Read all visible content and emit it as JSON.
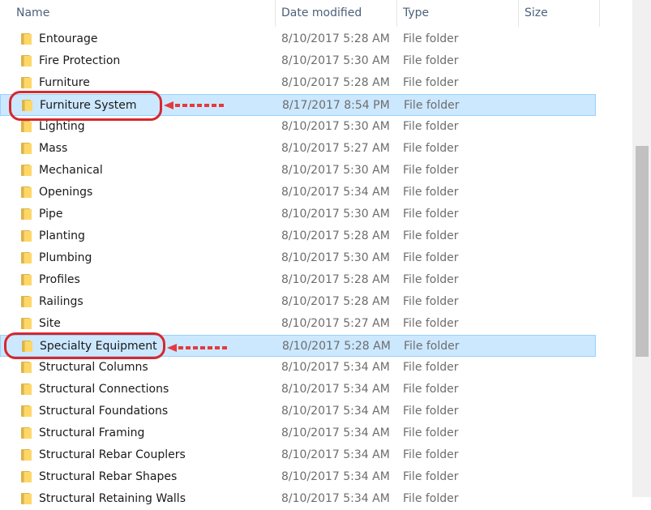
{
  "columns": {
    "name": "Name",
    "date_modified": "Date modified",
    "type": "Type",
    "size": "Size"
  },
  "sort_indicator": "^",
  "rows": [
    {
      "name": "Entourage",
      "date": "8/10/2017 5:28 AM",
      "type": "File folder",
      "selected": false
    },
    {
      "name": "Fire Protection",
      "date": "8/10/2017 5:30 AM",
      "type": "File folder",
      "selected": false
    },
    {
      "name": "Furniture",
      "date": "8/10/2017 5:28 AM",
      "type": "File folder",
      "selected": false
    },
    {
      "name": "Furniture System",
      "date": "8/17/2017 8:54 PM",
      "type": "File folder",
      "selected": true
    },
    {
      "name": "Lighting",
      "date": "8/10/2017 5:30 AM",
      "type": "File folder",
      "selected": false
    },
    {
      "name": "Mass",
      "date": "8/10/2017 5:27 AM",
      "type": "File folder",
      "selected": false
    },
    {
      "name": "Mechanical",
      "date": "8/10/2017 5:30 AM",
      "type": "File folder",
      "selected": false
    },
    {
      "name": "Openings",
      "date": "8/10/2017 5:34 AM",
      "type": "File folder",
      "selected": false
    },
    {
      "name": "Pipe",
      "date": "8/10/2017 5:30 AM",
      "type": "File folder",
      "selected": false
    },
    {
      "name": "Planting",
      "date": "8/10/2017 5:28 AM",
      "type": "File folder",
      "selected": false
    },
    {
      "name": "Plumbing",
      "date": "8/10/2017 5:30 AM",
      "type": "File folder",
      "selected": false
    },
    {
      "name": "Profiles",
      "date": "8/10/2017 5:28 AM",
      "type": "File folder",
      "selected": false
    },
    {
      "name": "Railings",
      "date": "8/10/2017 5:28 AM",
      "type": "File folder",
      "selected": false
    },
    {
      "name": "Site",
      "date": "8/10/2017 5:27 AM",
      "type": "File folder",
      "selected": false
    },
    {
      "name": "Specialty Equipment",
      "date": "8/10/2017 5:28 AM",
      "type": "File folder",
      "selected": true
    },
    {
      "name": "Structural Columns",
      "date": "8/10/2017 5:34 AM",
      "type": "File folder",
      "selected": false
    },
    {
      "name": "Structural Connections",
      "date": "8/10/2017 5:34 AM",
      "type": "File folder",
      "selected": false
    },
    {
      "name": "Structural Foundations",
      "date": "8/10/2017 5:34 AM",
      "type": "File folder",
      "selected": false
    },
    {
      "name": "Structural Framing",
      "date": "8/10/2017 5:34 AM",
      "type": "File folder",
      "selected": false
    },
    {
      "name": "Structural Rebar Couplers",
      "date": "8/10/2017 5:34 AM",
      "type": "File folder",
      "selected": false
    },
    {
      "name": "Structural Rebar Shapes",
      "date": "8/10/2017 5:34 AM",
      "type": "File folder",
      "selected": false
    },
    {
      "name": "Structural Retaining Walls",
      "date": "8/10/2017 5:34 AM",
      "type": "File folder",
      "selected": false
    }
  ],
  "icons": {
    "folder": "folder-icon",
    "sort": "sort-ascending-icon",
    "annotation_arrow": "arrow-left-icon"
  },
  "colors": {
    "selection_bg": "#cce8ff",
    "selection_border": "#99d1ff",
    "annotation_red": "#d6282e",
    "header_text": "#4c607a",
    "folder_yellow": "#ffd766"
  }
}
